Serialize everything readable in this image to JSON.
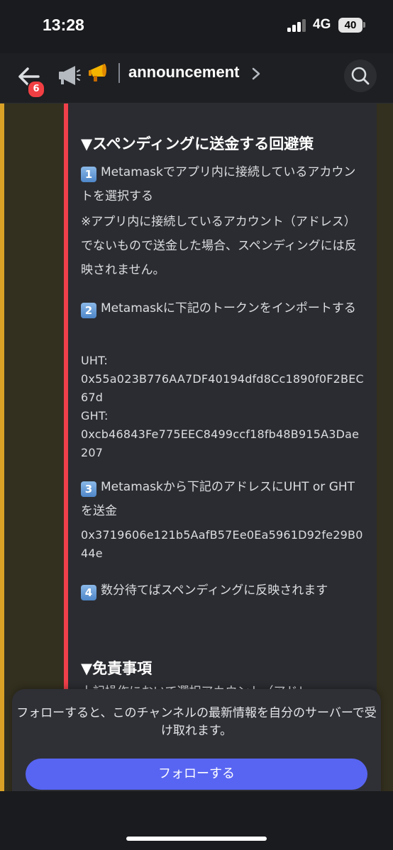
{
  "status": {
    "time": "13:28",
    "network": "4G",
    "battery": "40"
  },
  "header": {
    "channel_name": "announcement",
    "unread_badge": "6"
  },
  "message": {
    "heading1": "▼スペンディングに送金する回避策",
    "step1_num": "1",
    "step1_text": "Metamaskでアプリ内に接続しているアカウントを選択する",
    "note": "※アプリ内に接続しているアカウント（アドレス）でないもので送金した場合、スペンディングには反映されません。",
    "step2_num": "2",
    "step2_text": "Metamaskに下記のトークンをインポートする",
    "uht_label": "UHT:",
    "uht_address": "0x55a023B776AA7DF40194dfd8Cc1890f0F2BEC67d",
    "ght_label": "GHT:",
    "ght_address": "0xcb46843Fe775EEC8499ccf18fb48B915A3Dae207",
    "step3_num": "3",
    "step3_text": "Metamaskから下記のアドレスにUHT or GHTを送金",
    "send_address": "0x3719606e121b5AafB57Ee0Ea5961D92fe29B044e",
    "step4_num": "4",
    "step4_text": "数分待てばスペンディングに反映されます",
    "heading2": "▼免責事項",
    "cut_line": "上記操作において選択アカウント（アドレ"
  },
  "follow": {
    "description": "フォローすると、このチャンネルの最新情報を自分のサーバーで受け取れます。",
    "button_label": "フォローする"
  },
  "colors": {
    "accent": "#5865f2",
    "red_bar": "#f0404a",
    "badge": "#f23f43",
    "gold": "#d9a227"
  }
}
